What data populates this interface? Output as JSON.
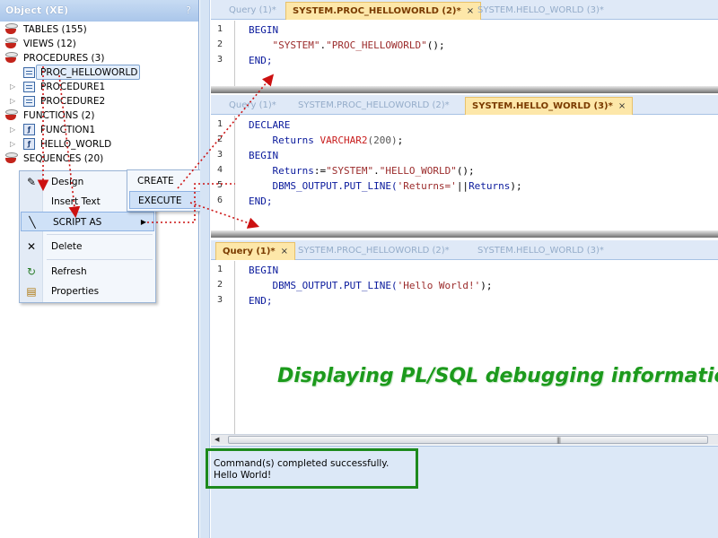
{
  "explorer": {
    "title": "Object (XE)",
    "help": "?",
    "nodes": [
      {
        "label": "TABLES (155)"
      },
      {
        "label": "VIEWS (12)"
      },
      {
        "label": "PROCEDURES (3)"
      },
      {
        "label": "PROC_HELLOWORLD"
      },
      {
        "label": "PROCEDURE1"
      },
      {
        "label": "PROCEDURE2"
      },
      {
        "label": "FUNCTIONS (2)"
      },
      {
        "label": "FUNCTION1"
      },
      {
        "label": "HELLO_WORLD"
      },
      {
        "label": "SEQUENCES (20)"
      }
    ]
  },
  "context_menu": {
    "items": [
      "Design",
      "Insert Text",
      "SCRIPT AS",
      "Delete",
      "Refresh",
      "Properties"
    ],
    "submenu": [
      "CREATE",
      "EXECUTE"
    ]
  },
  "editor1": {
    "tabs": [
      {
        "label": "Query (1)*",
        "active": false
      },
      {
        "label": "SYSTEM.PROC_HELLOWORLD (2)*",
        "active": true
      },
      {
        "label": "SYSTEM.HELLO_WORLD (3)*",
        "active": false
      }
    ],
    "lines": [
      "1",
      "2",
      "3"
    ],
    "code": {
      "l1_kw": "BEGIN",
      "l2_str1": "\"SYSTEM\"",
      "l2_dot": ".",
      "l2_str2": "\"PROC_HELLOWORLD\"",
      "l2_end": "();",
      "l3_kw": "END;"
    }
  },
  "editor2": {
    "tabs": [
      {
        "label": "Query (1)*",
        "active": false
      },
      {
        "label": "SYSTEM.PROC_HELLOWORLD (2)*",
        "active": false
      },
      {
        "label": "SYSTEM.HELLO_WORLD (3)*",
        "active": true
      }
    ],
    "lines": [
      "1",
      "2",
      "3",
      "4",
      "5",
      "6"
    ],
    "code": {
      "l1_kw": "DECLARE",
      "l2_id": "Returns",
      "l2_type": "VARCHAR2",
      "l2_num": "(200)",
      "l2_end": ";",
      "l3_kw": "BEGIN",
      "l4_id": "Returns",
      "l4_op": ":=",
      "l4_str1": "\"SYSTEM\"",
      "l4_dot": ".",
      "l4_str2": "\"HELLO_WORLD\"",
      "l4_end": "();",
      "l5_fn": "DBMS_OUTPUT.PUT_LINE(",
      "l5_str": "'Returns='",
      "l5_op": "||",
      "l5_id": "Returns",
      "l5_end": ");",
      "l6_kw": "END;"
    }
  },
  "editor3": {
    "tabs": [
      {
        "label": "Query (1)*",
        "active": true
      },
      {
        "label": "SYSTEM.PROC_HELLOWORLD (2)*",
        "active": false
      },
      {
        "label": "SYSTEM.HELLO_WORLD (3)*",
        "active": false
      }
    ],
    "lines": [
      "1",
      "2",
      "3"
    ],
    "code": {
      "l1_kw": "BEGIN",
      "l2_fn": "DBMS_OUTPUT.PUT_LINE(",
      "l2_str": "'Hello World!'",
      "l2_end": ");",
      "l3_kw": "END;"
    }
  },
  "output": {
    "lines": [
      "Command(s) completed successfully.",
      "Hello World!"
    ]
  },
  "caption": "Displaying PL/SQL debugging information",
  "colors": {
    "annotation_green": "#1d8a1d",
    "arrow_red": "#cc1111",
    "active_tab": "#fde7a9"
  }
}
